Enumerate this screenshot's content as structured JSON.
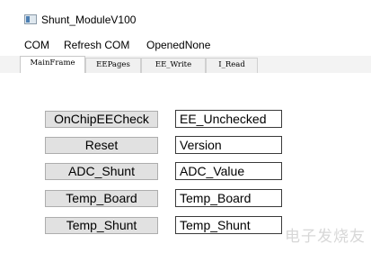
{
  "window": {
    "title": "Shunt_ModuleV100"
  },
  "menu": {
    "items": [
      "COM",
      "Refresh COM",
      "OpenedNone"
    ]
  },
  "tabs": [
    "MainFrame",
    "EEPages",
    "EE_Write",
    "I_Read"
  ],
  "active_tab": "MainFrame",
  "rows": [
    {
      "button": "OnChipEECheck",
      "value": "EE_Unchecked"
    },
    {
      "button": "Reset",
      "value": "Version"
    },
    {
      "button": "ADC_Shunt",
      "value": "ADC_Value"
    },
    {
      "button": "Temp_Board",
      "value": "Temp_Board"
    },
    {
      "button": "Temp_Shunt",
      "value": "Temp_Shunt"
    }
  ],
  "watermark": "电子发烧友"
}
